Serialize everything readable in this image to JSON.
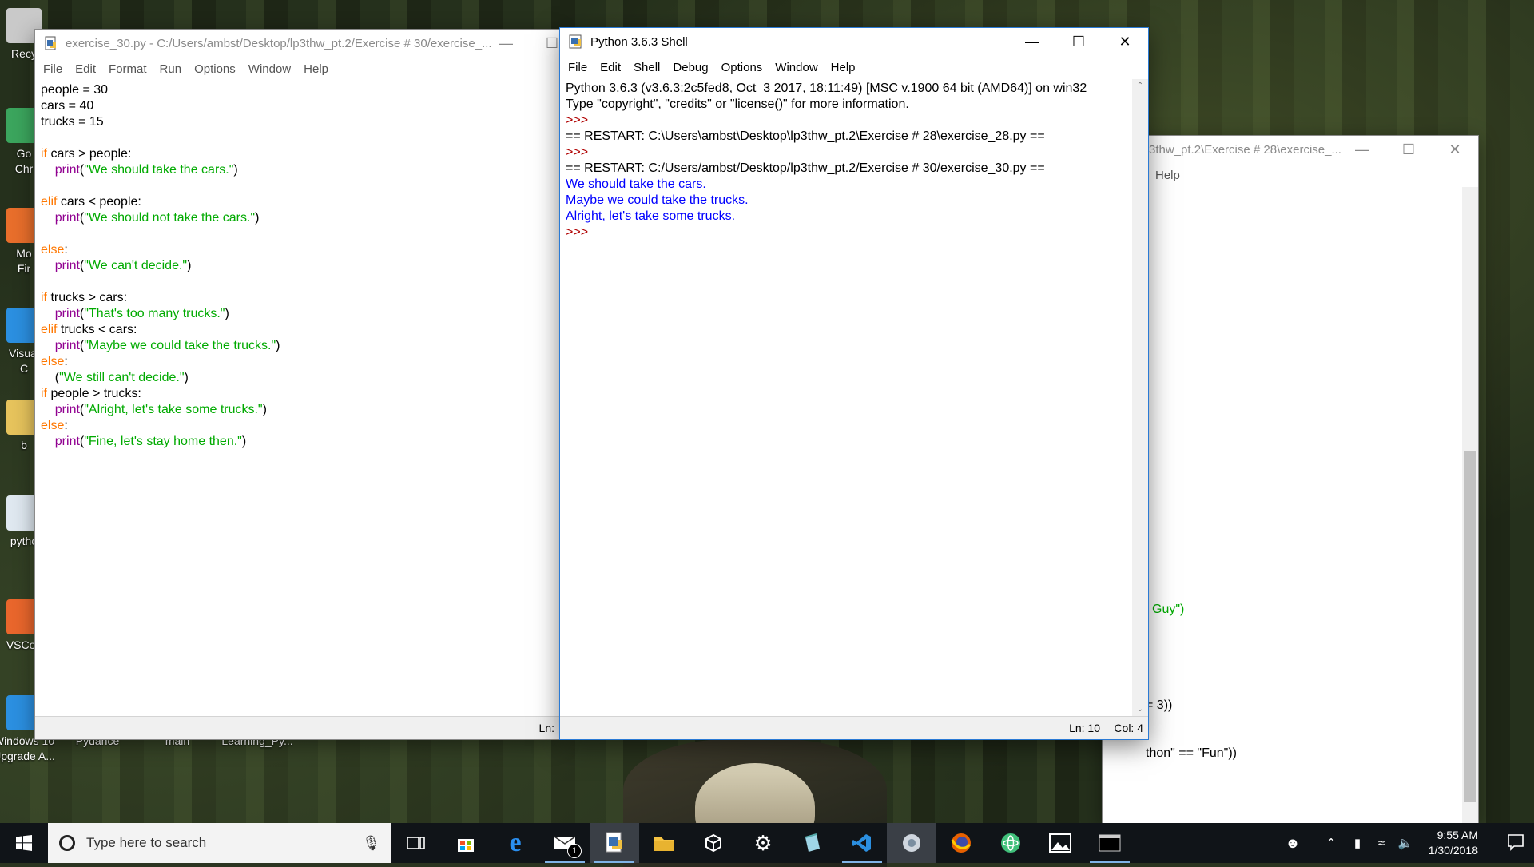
{
  "desktop_icons": [
    {
      "label": "Recy",
      "color": "#c9c9c9"
    },
    {
      "label": "Go\nChr",
      "color": "#3ba55d"
    },
    {
      "label": "Mo\nFir",
      "color": "#e86e2b"
    },
    {
      "label": "Visual\nC",
      "color": "#2b8fe0"
    },
    {
      "label": "b",
      "color": "#e6c35c"
    },
    {
      "label": "pytho",
      "color": "#dfe8f0"
    },
    {
      "label": "VSCod",
      "color": "#e9662c"
    },
    {
      "label": "Windows 10\nUpgrade A...",
      "color": "#2b8fe0"
    },
    {
      "label": "Pydance",
      "color": "#6a6a6a"
    },
    {
      "label": "main",
      "color": "#6a6a6a"
    },
    {
      "label": "Learning_Py...",
      "color": "#6a6a6a"
    }
  ],
  "editor_window": {
    "title": "exercise_30.py - C:/Users/ambst/Desktop/lp3thw_pt.2/Exercise # 30/exercise_...",
    "menu": [
      "File",
      "Edit",
      "Format",
      "Run",
      "Options",
      "Window",
      "Help"
    ],
    "status": "Ln:",
    "code": [
      [
        {
          "t": "people = 30",
          "c": ""
        }
      ],
      [
        {
          "t": "cars = 40",
          "c": ""
        }
      ],
      [
        {
          "t": "trucks = 15",
          "c": ""
        }
      ],
      [
        {
          "t": "",
          "c": ""
        }
      ],
      [
        {
          "t": "if",
          "c": "kw"
        },
        {
          "t": " cars > people:",
          "c": ""
        }
      ],
      [
        {
          "t": "    ",
          "c": ""
        },
        {
          "t": "print",
          "c": "bi"
        },
        {
          "t": "(",
          "c": ""
        },
        {
          "t": "\"We should take the cars.\"",
          "c": "str"
        },
        {
          "t": ")",
          "c": ""
        }
      ],
      [
        {
          "t": "",
          "c": ""
        }
      ],
      [
        {
          "t": "elif",
          "c": "kw"
        },
        {
          "t": " cars < people:",
          "c": ""
        }
      ],
      [
        {
          "t": "    ",
          "c": ""
        },
        {
          "t": "print",
          "c": "bi"
        },
        {
          "t": "(",
          "c": ""
        },
        {
          "t": "\"We should not take the cars.\"",
          "c": "str"
        },
        {
          "t": ")",
          "c": ""
        }
      ],
      [
        {
          "t": "",
          "c": ""
        }
      ],
      [
        {
          "t": "else",
          "c": "kw"
        },
        {
          "t": ":",
          "c": ""
        }
      ],
      [
        {
          "t": "    ",
          "c": ""
        },
        {
          "t": "print",
          "c": "bi"
        },
        {
          "t": "(",
          "c": ""
        },
        {
          "t": "\"We can't decide.\"",
          "c": "str"
        },
        {
          "t": ")",
          "c": ""
        }
      ],
      [
        {
          "t": "",
          "c": ""
        }
      ],
      [
        {
          "t": "if",
          "c": "kw"
        },
        {
          "t": " trucks > cars:",
          "c": ""
        }
      ],
      [
        {
          "t": "    ",
          "c": ""
        },
        {
          "t": "print",
          "c": "bi"
        },
        {
          "t": "(",
          "c": ""
        },
        {
          "t": "\"That's too many trucks.\"",
          "c": "str"
        },
        {
          "t": ")",
          "c": ""
        }
      ],
      [
        {
          "t": "elif",
          "c": "kw"
        },
        {
          "t": " trucks < cars:",
          "c": ""
        }
      ],
      [
        {
          "t": "    ",
          "c": ""
        },
        {
          "t": "print",
          "c": "bi"
        },
        {
          "t": "(",
          "c": ""
        },
        {
          "t": "\"Maybe we could take the trucks.\"",
          "c": "str"
        },
        {
          "t": ")",
          "c": ""
        }
      ],
      [
        {
          "t": "else",
          "c": "kw"
        },
        {
          "t": ":",
          "c": ""
        }
      ],
      [
        {
          "t": "    (",
          "c": ""
        },
        {
          "t": "\"We still can't decide.\"",
          "c": "str"
        },
        {
          "t": ")",
          "c": ""
        }
      ],
      [
        {
          "t": "if",
          "c": "kw"
        },
        {
          "t": " people > trucks:",
          "c": ""
        }
      ],
      [
        {
          "t": "    ",
          "c": ""
        },
        {
          "t": "print",
          "c": "bi"
        },
        {
          "t": "(",
          "c": ""
        },
        {
          "t": "\"Alright, let's take some trucks.\"",
          "c": "str"
        },
        {
          "t": ")",
          "c": ""
        }
      ],
      [
        {
          "t": "else",
          "c": "kw"
        },
        {
          "t": ":",
          "c": ""
        }
      ],
      [
        {
          "t": "    ",
          "c": ""
        },
        {
          "t": "print",
          "c": "bi"
        },
        {
          "t": "(",
          "c": ""
        },
        {
          "t": "\"Fine, let's stay home then.\"",
          "c": "str"
        },
        {
          "t": ")",
          "c": ""
        }
      ]
    ]
  },
  "shell_window": {
    "title": "Python 3.6.3 Shell",
    "menu": [
      "File",
      "Edit",
      "Shell",
      "Debug",
      "Options",
      "Window",
      "Help"
    ],
    "status_ln": "Ln: 10",
    "status_col": "Col: 4",
    "lines": [
      [
        {
          "t": "Python 3.6.3 (v3.6.3:2c5fed8, Oct  3 2017, 18:11:49) [MSC v.1900 64 bit (AMD64)] on win32",
          "c": ""
        }
      ],
      [
        {
          "t": "Type \"copyright\", \"credits\" or \"license()\" for more information.",
          "c": ""
        }
      ],
      [
        {
          "t": ">>> ",
          "c": "prompt"
        }
      ],
      [
        {
          "t": "== RESTART: C:\\Users\\ambst\\Desktop\\lp3thw_pt.2\\Exercise # 28\\exercise_28.py ==",
          "c": ""
        }
      ],
      [
        {
          "t": ">>> ",
          "c": "prompt"
        }
      ],
      [
        {
          "t": "== RESTART: C:/Users/ambst/Desktop/lp3thw_pt.2/Exercise # 30/exercise_30.py ==",
          "c": ""
        }
      ],
      [
        {
          "t": "We should take the cars.",
          "c": "out"
        }
      ],
      [
        {
          "t": "Maybe we could take the trucks.",
          "c": "out"
        }
      ],
      [
        {
          "t": "Alright, let's take some trucks.",
          "c": "out"
        }
      ],
      [
        {
          "t": ">>> ",
          "c": "prompt"
        }
      ]
    ]
  },
  "back_window": {
    "title": "3thw_pt.2\\Exercise # 28\\exercise_...",
    "menu_help": "Help",
    "lines": [
      {
        "t": "l Guy\")"
      },
      {
        "t": "= 3))"
      },
      {
        "t": "thon\" == \"Fun\"))"
      }
    ]
  },
  "taskbar": {
    "search_placeholder": "Type here to search",
    "clock_time": "9:55 AM",
    "clock_date": "1/30/2018",
    "mail_badge": "1",
    "apps": [
      "task-view",
      "store",
      "edge",
      "mail",
      "python-idle",
      "file-explorer",
      "unity",
      "settings",
      "notepad",
      "vscode",
      "unknown-app",
      "firefox",
      "atom",
      "photos",
      "terminal"
    ]
  }
}
